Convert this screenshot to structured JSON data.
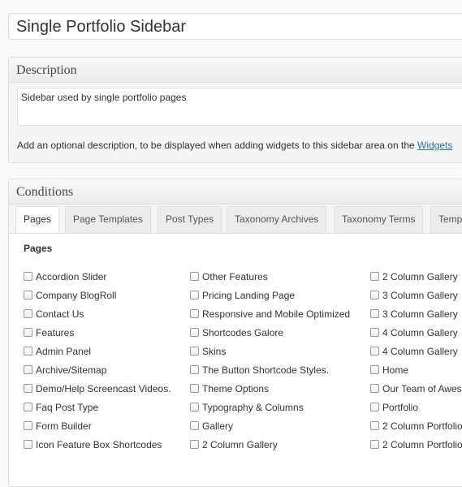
{
  "sidebar_name": "Single Portfolio Sidebar",
  "description": {
    "header": "Description",
    "value": "Sidebar used by single portfolio pages",
    "help_text": "Add an optional description, to be displayed when adding widgets to this sidebar area on the",
    "help_link": "Widgets"
  },
  "conditions": {
    "header": "Conditions",
    "tabs": [
      {
        "label": "Pages"
      },
      {
        "label": "Page Templates"
      },
      {
        "label": "Post Types"
      },
      {
        "label": "Taxonomy Archives"
      },
      {
        "label": "Taxonomy Terms"
      },
      {
        "label": "Temp"
      }
    ],
    "panel_title": "Pages",
    "columns": [
      [
        "Accordion Slider",
        "Company BlogRoll",
        "Contact Us",
        "Features",
        "Admin Panel",
        "Archive/Sitemap",
        "Demo/Help Screencast Videos.",
        "Faq Post Type",
        "Form Builder",
        "Icon Feature Box Shortcodes"
      ],
      [
        "Other Features",
        "Pricing Landing Page",
        "Responsive and Mobile Optimized",
        "Shortcodes Galore",
        "Skins",
        "The Button Shortcode Styles.",
        "Theme Options",
        "Typography & Columns",
        "Gallery",
        "2 Column Gallery"
      ],
      [
        "2 Column Gallery",
        "3 Column Gallery",
        "3 Column Gallery",
        "4 Column Gallery",
        "4 Column Gallery",
        "Home",
        "Our Team of Awes",
        "Portfolio",
        "2 Column Portfolio",
        "2 Column Portfolio"
      ]
    ]
  }
}
